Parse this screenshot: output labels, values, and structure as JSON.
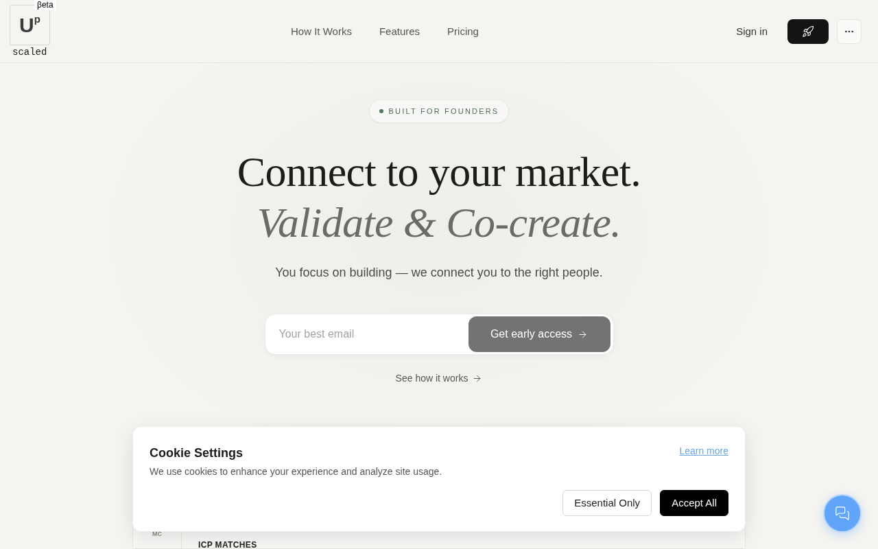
{
  "header": {
    "logo": {
      "mark": "U$^{p}$",
      "badge": "βeta",
      "wordmark": "scaled"
    },
    "nav": [
      "How It Works",
      "Features",
      "Pricing"
    ],
    "sign_in": "Sign in"
  },
  "hero": {
    "badge": "BUILT FOR FOUNDERS",
    "title": "Connect to your market.",
    "title_italic": "Validate & Co-create.",
    "subtitle": "You focus on building — we connect you to the right people.",
    "email_placeholder": "Your best email",
    "cta": "Get early access",
    "secondary_link": "See how it works"
  },
  "preview": {
    "avatar": "MC",
    "section_label": "ICP MATCHES"
  },
  "cookie_banner": {
    "title": "Cookie Settings",
    "text": "We use cookies to enhance your experience and analyze site usage.",
    "link": "Learn more",
    "buttons": [
      {
        "label": "Essential Only",
        "kind": "outline"
      },
      {
        "label": "Accept All",
        "kind": "primary"
      }
    ]
  }
}
